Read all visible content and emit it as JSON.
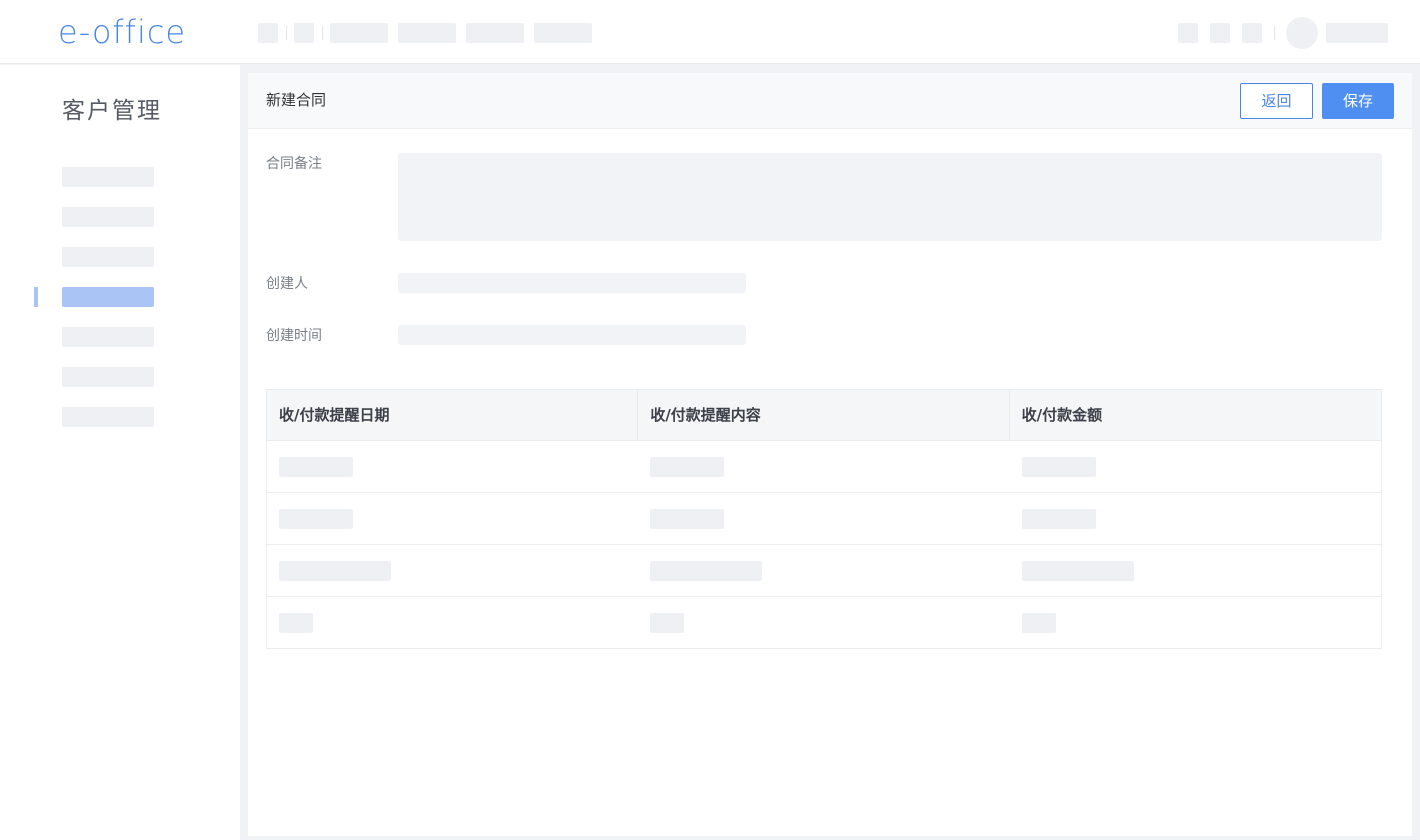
{
  "app": {
    "logo_text": "e-office"
  },
  "sidebar": {
    "title": "客户管理",
    "active_index": 3
  },
  "page": {
    "title": "新建合同",
    "back_label": "返回",
    "save_label": "保存"
  },
  "form": {
    "remark_label": "合同备注",
    "creator_label": "创建人",
    "created_time_label": "创建时间"
  },
  "table": {
    "columns": [
      "收/付款提醒日期",
      "收/付款提醒内容",
      "收/付款金额"
    ]
  },
  "colors": {
    "accent": "#4a85e8",
    "primary_button": "#4f8ff2",
    "active_nav": "#a9c4f5",
    "placeholder": "#eef0f3"
  }
}
